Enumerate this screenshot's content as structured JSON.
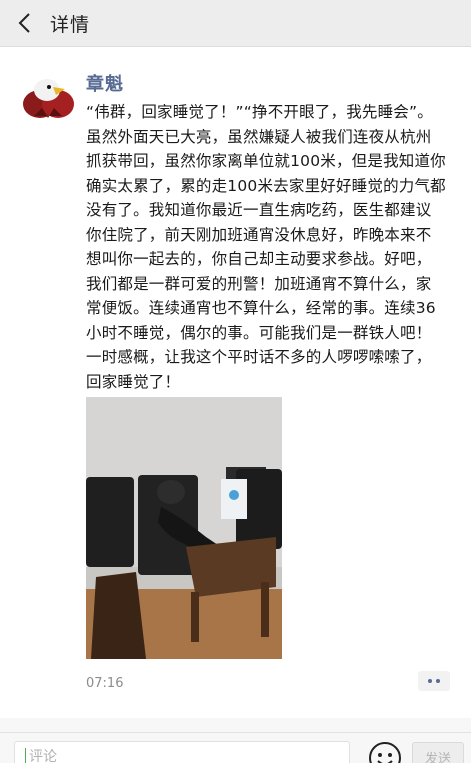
{
  "header": {
    "title": "详情"
  },
  "post": {
    "author": "章魁",
    "text": "“伟群，回家睡觉了！”“挣不开眼了，我先睡会”。虽然外面天已大亮，虽然嫌疑人被我们连夜从杭州抓获带回，虽然你家离单位就100米，但是我知道你确实太累了，累的走100米去家里好好睡觉的力气都没有了。我知道你最近一直生病吃药，医生都建议你住院了，前天刚加班通宵没休息好，昨晚本来不想叫你一起去的，你自己却主动要求参战。好吧，我们都是一群可爱的刑警！加班通宵不算什么，家常便饭。连续通宵也不算什么，经常的事。连续36小时不睡觉，偶尔的事。可能我们是一群铁人吧！一时感概，让我这个平时话不多的人啰啰嗦嗦了，回家睡觉了！",
    "time": "07:16",
    "photo_icon": "photo-office-sleeping"
  },
  "comment": {
    "placeholder": "评论",
    "send_label": "发送"
  },
  "colors": {
    "author": "#576b95",
    "topbar": "#ededed"
  }
}
